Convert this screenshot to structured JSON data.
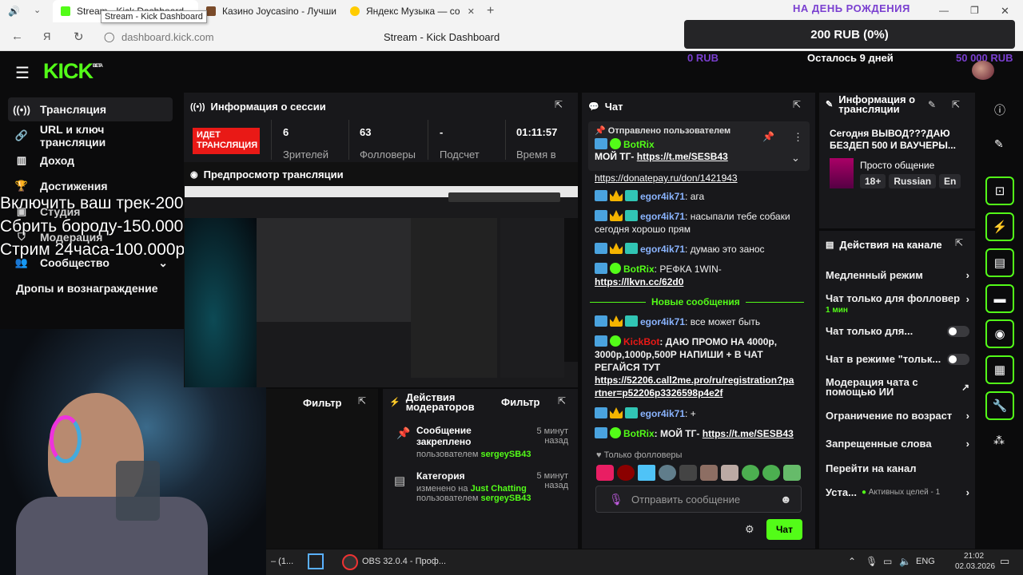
{
  "browser": {
    "tabs": [
      {
        "label": "Stream - Kick Dashboard",
        "short": "Stream - Kick Dashboard"
      },
      {
        "label": "Казино Joycasino - Лучши"
      },
      {
        "label": "Яндекс Музыка — со"
      }
    ],
    "tooltip": "Stream - Kick Dashboard",
    "url": "dashboard.kick.com",
    "page_title": "Stream - Kick Dashboard"
  },
  "goal_widget": {
    "title": "НА ДЕНЬ РОЖДЕНИЯ",
    "amount": "200 RUB (0%)",
    "min": "0 RUB",
    "remaining": "Осталось 9 дней",
    "max": "50 000 RUB"
  },
  "header": {
    "logo": "KICK",
    "logo_sup": "BETA"
  },
  "sidebar": {
    "items": [
      {
        "label": "Трансляция",
        "icon": "broadcast-icon"
      },
      {
        "label": "URL и ключ трансляции",
        "icon": "link-icon"
      },
      {
        "label": "Доход",
        "icon": "chart-icon"
      },
      {
        "label": "Достижения",
        "icon": "trophy-icon"
      },
      {
        "label": "Студия",
        "icon": "studio-icon"
      },
      {
        "label": "Модерация",
        "icon": "shield-icon"
      },
      {
        "label": "Сообщество",
        "icon": "community-icon"
      },
      {
        "label": "Дропы и вознаграждение",
        "icon": "gift-icon"
      }
    ]
  },
  "overlay": {
    "lines": [
      "Включить ваш трек-200р",
      "Сбрить бороду-150.000р",
      "Стрим 24часа-100.000р"
    ]
  },
  "session": {
    "title": "Информация о сессии",
    "live_badge": "ИДЕТ ТРАНСЛЯЦИЯ",
    "stats": [
      {
        "value": "6",
        "label": "Зрителей"
      },
      {
        "value": "63",
        "label": "Фолловеры"
      },
      {
        "value": "-",
        "label": "Подсчет"
      },
      {
        "value": "01:11:57",
        "label": "Время в"
      }
    ]
  },
  "preview": {
    "title": "Предпросмотр трансляции"
  },
  "filters": {
    "left": "Фильтр",
    "right": "Фильтр"
  },
  "mod_actions": {
    "title": "Действия модераторов",
    "items": [
      {
        "title": "Сообщение закреплено",
        "time": "5 минут назад",
        "by": "пользователем",
        "user": "sergeySB43",
        "icon": "pin-icon"
      },
      {
        "title": "Категория",
        "time": "5 минут назад",
        "line": "изменено на",
        "value": "Just Chatting",
        "by": "пользователем",
        "user": "sergeySB43",
        "icon": "category-icon"
      }
    ]
  },
  "chat": {
    "title": "Чат",
    "pinned_label": "Отправлено пользователем",
    "pinned_user": "BotRix",
    "pinned_text": "МОЙ ТГ-",
    "pinned_link": "https://t.me/SESB43",
    "top_link": "https://donatepay.ru/don/1421943",
    "new_messages": "Новые сообщения",
    "messages": [
      {
        "user": "egor4ik71",
        "text": ": ага"
      },
      {
        "user": "egor4ik71",
        "text": ": насыпали тебе собаки сегодня хорошо прям"
      },
      {
        "user": "egor4ik71",
        "text": ": думаю это занос"
      },
      {
        "user": "BotRix",
        "text": ": РЕФКА 1WIN-",
        "link": "https://lkvn.cc/62d0"
      },
      {
        "user": "egor4ik71",
        "text": ": все может быть"
      },
      {
        "user": "KickBot",
        "text": ": ДАЮ ПРОМО НА 4000р, 3000р,1000р,500Р НАПИШИ + В ЧАТ РЕГАЙСЯ ТУТ",
        "link": "https://52206.call2me.pro/ru/registration?partner=p52206p3326598p4e2f"
      },
      {
        "user": "egor4ik71",
        "text": ": +"
      },
      {
        "user": "BotRix",
        "text": ": МОЙ ТГ-",
        "link": "https://t.me/SESB43"
      }
    ],
    "followers_only": "Только фолловеры",
    "input_placeholder": "Отправить сообщение",
    "send_label": "Чат"
  },
  "stream_info": {
    "title": "Информация о трансляции",
    "stream_title": "Сегодня ВЫВОД???ДАЮ БЕЗДЕП 500 И ВАУЧЕРЫ...",
    "category": "Просто общение",
    "tags": [
      "18+",
      "Russian",
      "En"
    ]
  },
  "channel_actions": {
    "title": "Действия на канале",
    "items": [
      {
        "label": "Медленный режим",
        "control": "chevron"
      },
      {
        "label": "Чат только для фолловер",
        "sub": "1 мин",
        "control": "chevron"
      },
      {
        "label": "Чат только для...",
        "control": "toggle"
      },
      {
        "label": "Чат в режиме \"тольк...",
        "control": "toggle"
      },
      {
        "label": "Модерация чата с помощью ИИ",
        "control": "external"
      },
      {
        "label": "Ограничение по возраст",
        "control": "chevron"
      },
      {
        "label": "Запрещенные слова",
        "control": "chevron"
      },
      {
        "label": "Перейти на канал",
        "control": "none"
      },
      {
        "label": "Уста...",
        "sub": "Активных целей - 1",
        "control": "chevron"
      }
    ]
  },
  "taskbar": {
    "left_text": "– (1...",
    "obs": "OBS 32.0.4 - Проф...",
    "lang": "ENG",
    "time": "21:02",
    "date": "02.03.2026"
  },
  "colors": {
    "accent": "#53fc18",
    "live": "#e91916",
    "panel": "#18181b",
    "bg": "#0b0b0c"
  }
}
